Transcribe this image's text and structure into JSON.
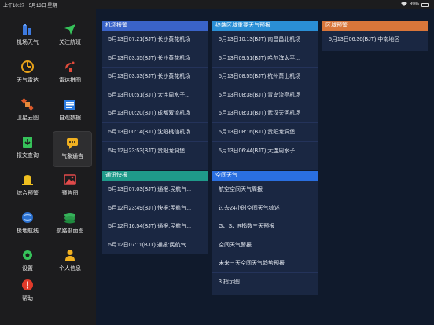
{
  "status": {
    "time": "上午10:27",
    "date": "5月13日 星期一",
    "battery": "89%"
  },
  "sidebar": {
    "items": [
      {
        "label": "机场天气"
      },
      {
        "label": "关注航班"
      },
      {
        "label": "天气雷达"
      },
      {
        "label": "雷达拼图"
      },
      {
        "label": "卫星云图"
      },
      {
        "label": "自观数据"
      },
      {
        "label": "报文查询"
      },
      {
        "label": "气象通告"
      },
      {
        "label": "综合预警"
      },
      {
        "label": "预告图"
      },
      {
        "label": "极地航线"
      },
      {
        "label": "航路剖面图"
      },
      {
        "label": "设置"
      },
      {
        "label": "个人信息"
      },
      {
        "label": "帮助"
      }
    ]
  },
  "panels": {
    "airport_alert": {
      "title": "机场报警",
      "rows": [
        "5月13日07:21(BJT) 长沙黄花机场",
        "5月13日03:35(BJT) 长沙黄花机场",
        "5月13日03:33(BJT) 长沙黄花机场",
        "5月13日00:51(BJT) 大连周水子...",
        "5月13日00:20(BJT) 成都双流机场",
        "5月13日00:14(BJT) 沈阳桃仙机场",
        "5月12日23:53(BJT) 贵阳龙洞堡..."
      ]
    },
    "terminal_forecast": {
      "title": "终端区域重要天气预报",
      "rows": [
        "5月13日10:13(BJT) 南昌昌北机场",
        "5月13日09:51(BJT) 哈尔滨太平...",
        "5月13日08:55(BJT) 杭州萧山机场",
        "5月13日08:38(BJT) 青岛流亭机场",
        "5月13日08:31(BJT) 武汉天河机场",
        "5月13日08:16(BJT) 贵阳龙洞堡...",
        "5月13日06:44(BJT) 大连周水子..."
      ]
    },
    "regional_warning": {
      "title": "区域预警",
      "rows": [
        "5月13日06:36(BJT) 中南地区"
      ]
    },
    "bulletin": {
      "title": "通讯快报",
      "rows": [
        "5月13日07:03(BJT) 通报:民航气...",
        "5月12日23:49(BJT) 快报:民航气...",
        "5月12日16:54(BJT) 通报:民航气...",
        "5月12日07:11(BJT) 通报:民航气..."
      ]
    },
    "space_weather": {
      "title": "空间天气",
      "rows": [
        "航空空间天气周报",
        "过去24小时空间天气综述",
        "G、S、R指数三天预报",
        "空间天气警报",
        "未来三天空间天气趋势预报",
        "3 指示图"
      ]
    }
  },
  "colors": {
    "header_airport": "#3a63c8",
    "header_terminal": "#2a8fd6",
    "header_regional": "#d9763a",
    "header_bulletin": "#1f9a8a",
    "header_space": "#2a6fe0",
    "panel_bg": "#1a2742",
    "main_bg": "#101a2c"
  }
}
